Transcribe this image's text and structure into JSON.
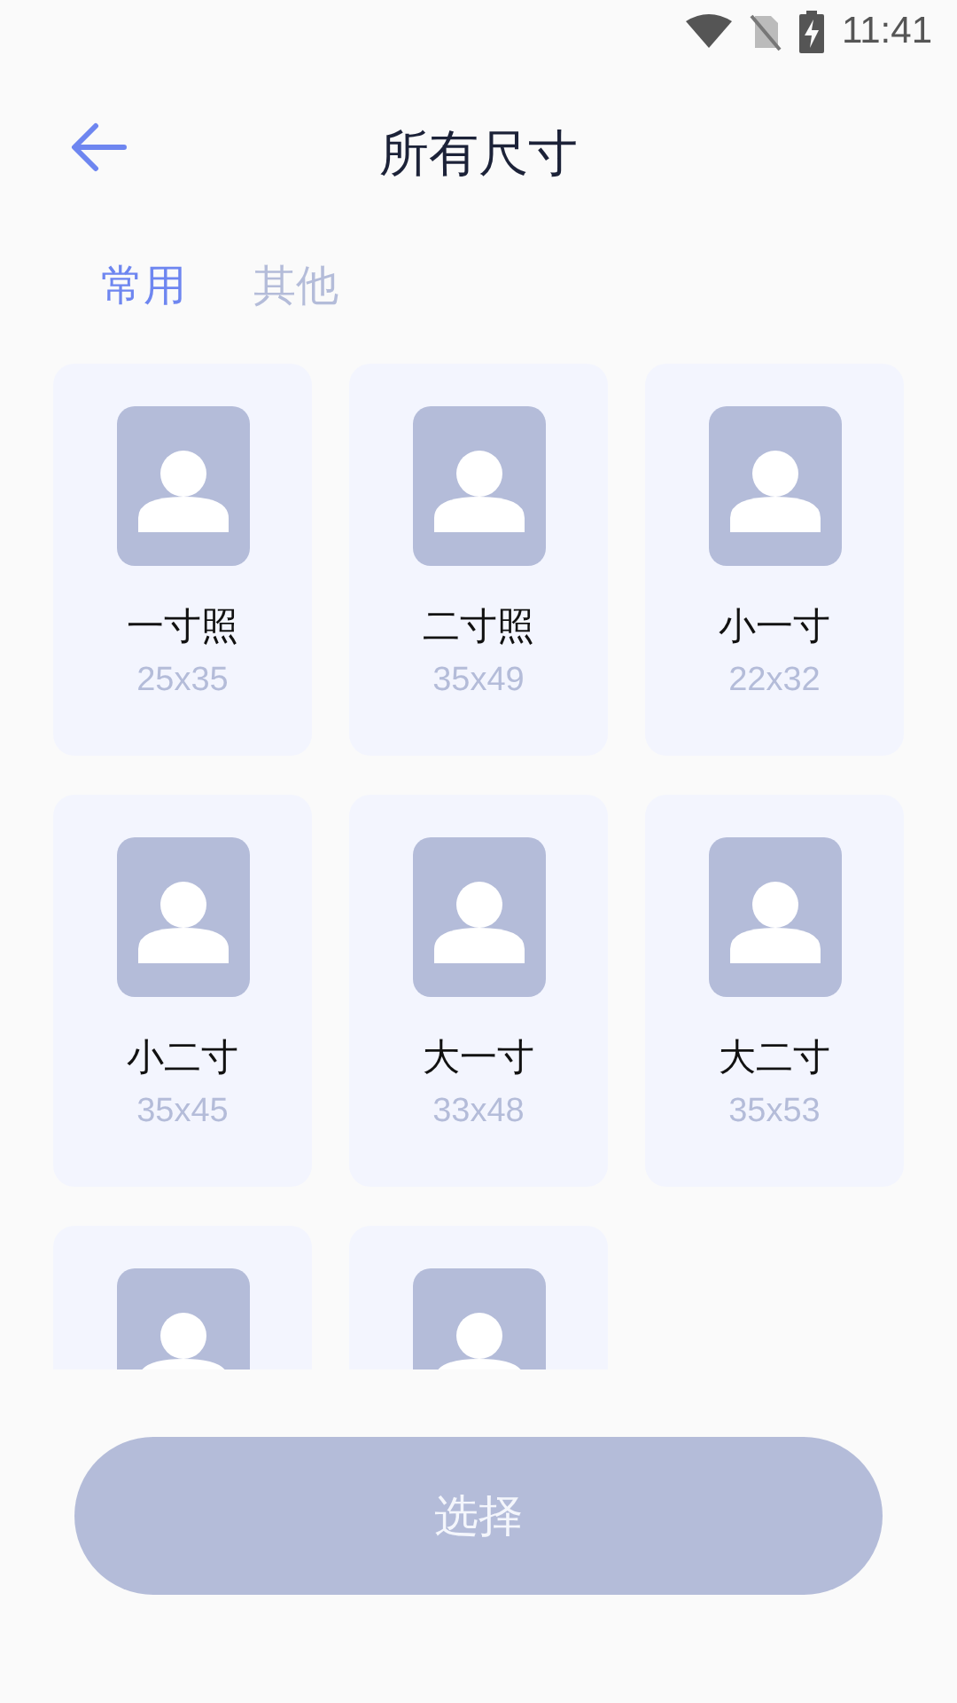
{
  "status_bar": {
    "time": "11:41"
  },
  "header": {
    "title": "所有尺寸"
  },
  "tabs": [
    {
      "label": "常用",
      "selected": true
    },
    {
      "label": "其他",
      "selected": false
    }
  ],
  "sizes": [
    {
      "kind": "full",
      "name": "一寸照",
      "dimensions": "25x35"
    },
    {
      "kind": "full",
      "name": "二寸照",
      "dimensions": "35x49"
    },
    {
      "kind": "full",
      "name": "小一寸",
      "dimensions": "22x32"
    },
    {
      "kind": "full",
      "name": "小二寸",
      "dimensions": "35x45"
    },
    {
      "kind": "full",
      "name": "大一寸",
      "dimensions": "33x48"
    },
    {
      "kind": "full",
      "name": "大二寸",
      "dimensions": "35x53"
    },
    {
      "kind": "clipped"
    },
    {
      "kind": "clipped"
    }
  ],
  "select_button": {
    "label": "选择",
    "disabled": true
  }
}
